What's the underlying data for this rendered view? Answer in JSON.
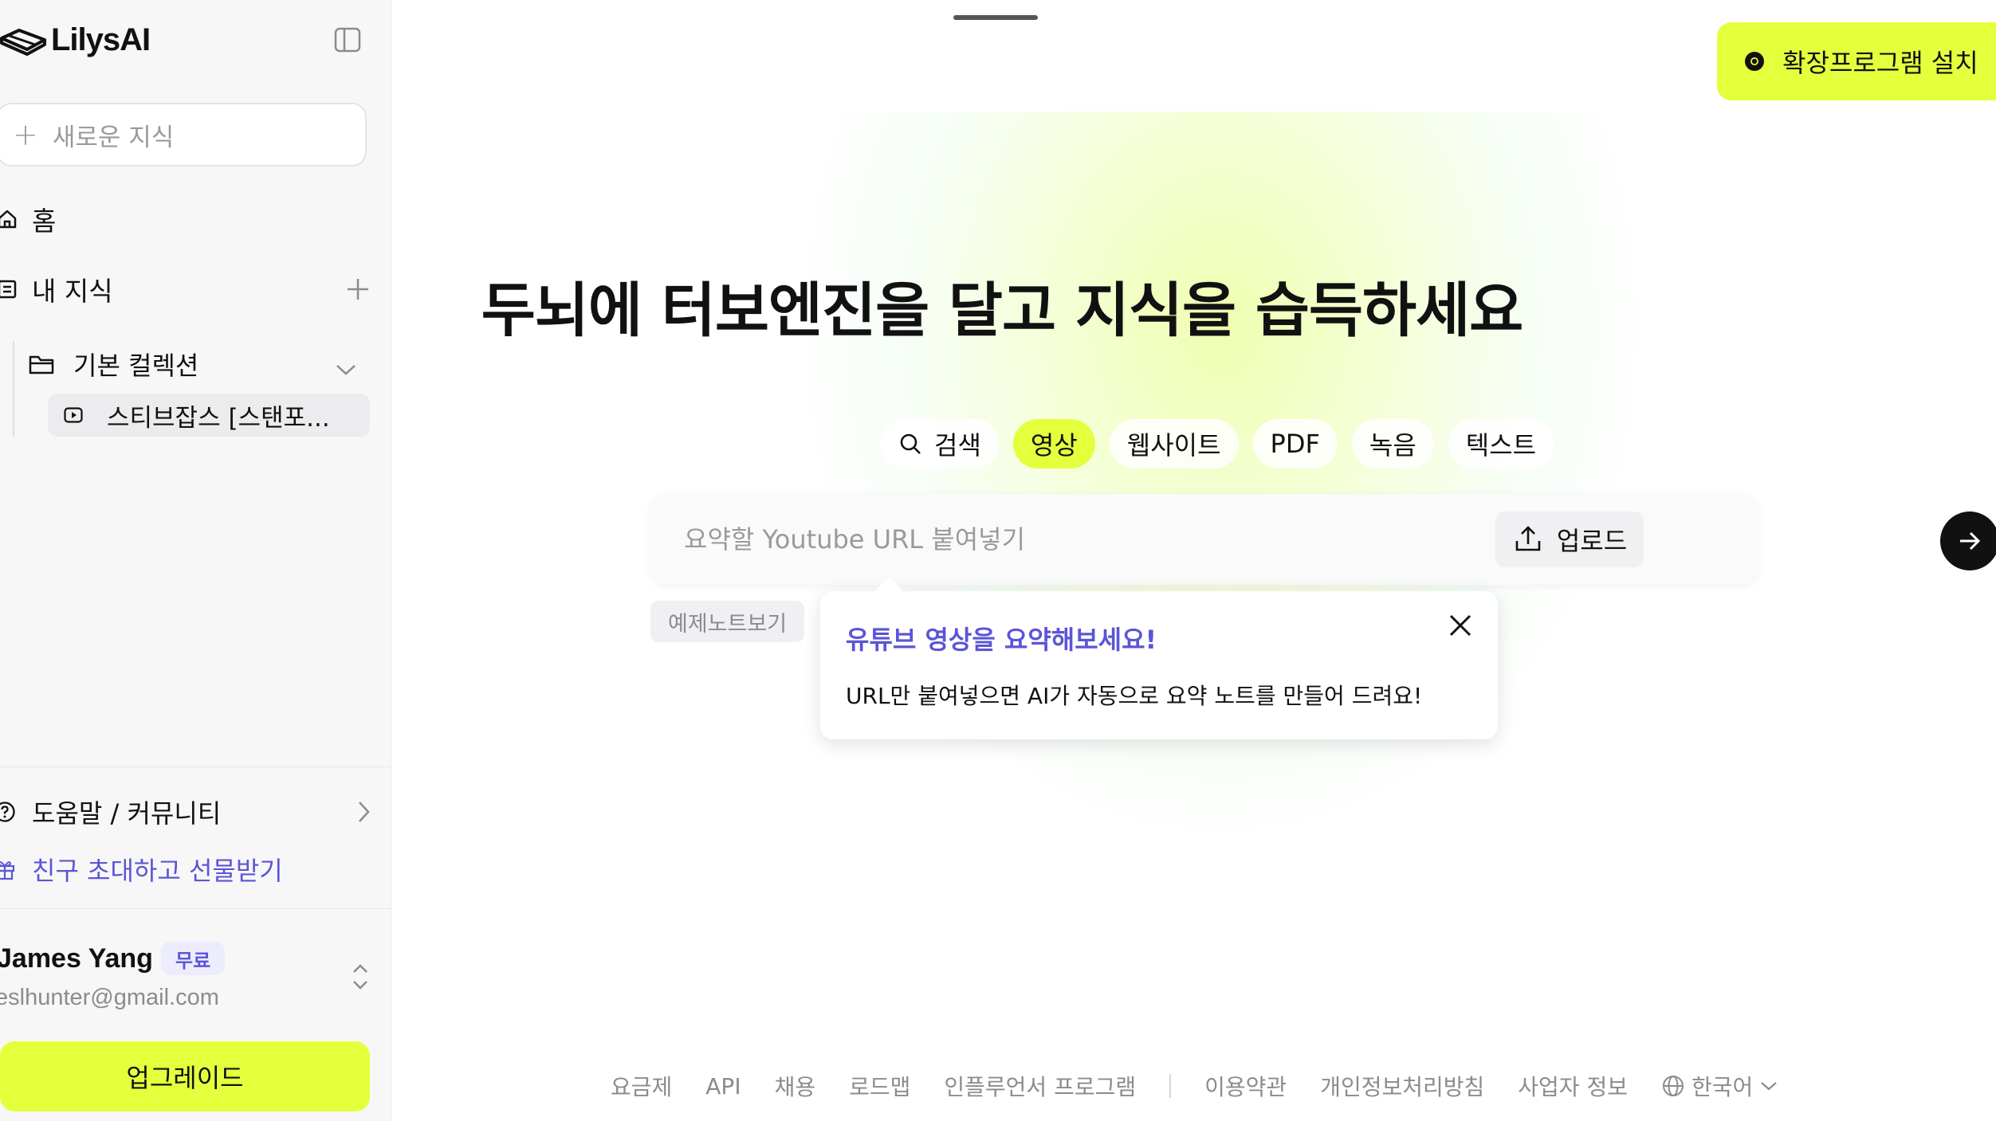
{
  "app": {
    "logo_text": "LilysAI"
  },
  "sidebar": {
    "new_note_label": "새로운 지식",
    "home_label": "홈",
    "my_knowledge_label": "내 지식",
    "collection": {
      "name": "기본 컬렉션",
      "items": [
        {
          "title": "스티브잡스 [스탠포..."
        }
      ]
    },
    "help_label": "도움말 / 커뮤니티",
    "invite_label": "친구 초대하고 선물받기",
    "user": {
      "name": "James Yang",
      "plan": "무료",
      "email": "eslhunter@gmail.com"
    },
    "upgrade_label": "업그레이드"
  },
  "header": {
    "extension_label": "확장프로그램 설치"
  },
  "main": {
    "headline": "두뇌에 터보엔진을 달고 지식을 습득하세요",
    "tabs": [
      {
        "label": "검색",
        "icon": "search-icon",
        "active": false
      },
      {
        "label": "영상",
        "active": true
      },
      {
        "label": "웹사이트",
        "active": false
      },
      {
        "label": "PDF",
        "active": false
      },
      {
        "label": "녹음",
        "active": false
      },
      {
        "label": "텍스트",
        "active": false
      }
    ],
    "url_placeholder": "요약할 Youtube URL 붙여넣기",
    "url_value": "",
    "upload_label": "업로드",
    "example_label": "예제노트보기",
    "tooltip": {
      "title": "유튜브 영상을 요약해보세요!",
      "body": "URL만 붙여넣으면 AI가 자동으로 요약 노트를 만들어 드려요!"
    }
  },
  "footer": {
    "links_left": [
      "요금제",
      "API",
      "채용",
      "로드맵",
      "인플루언서 프로그램"
    ],
    "links_right": [
      "이용약관",
      "개인정보처리방침",
      "사업자 정보"
    ],
    "language": "한국어"
  },
  "colors": {
    "accent": "#e4ff3c",
    "link_purple": "#5b55d6",
    "muted": "#8b8b90"
  }
}
